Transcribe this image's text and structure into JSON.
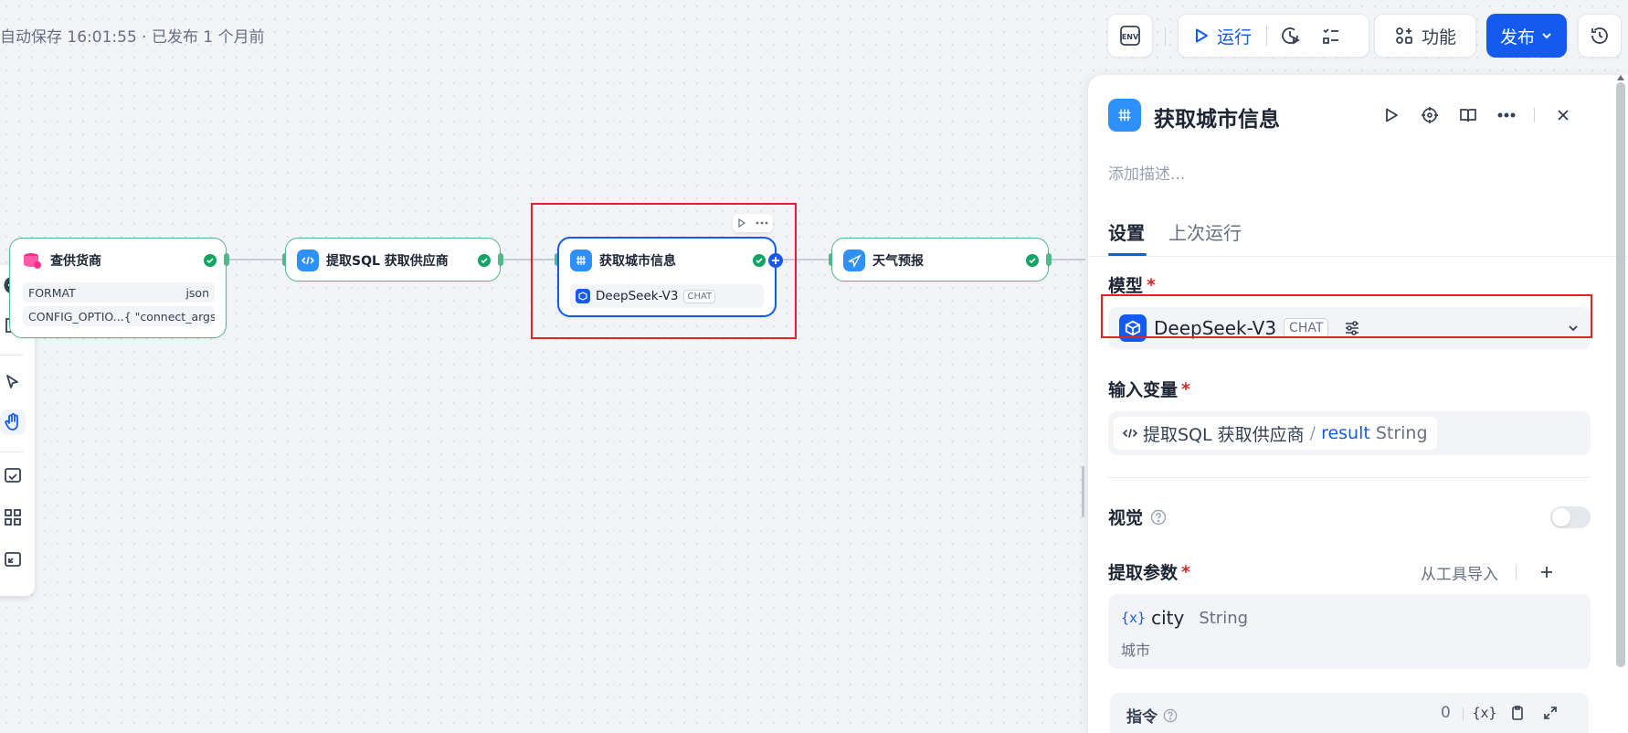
{
  "status_text": "自动保存 16:01:55 · 已发布 1 个月前",
  "toolbar": {
    "env_label": "ENV",
    "run_label": "运行",
    "features_label": "功能",
    "publish_label": "发布"
  },
  "nodes": {
    "supplier": {
      "title": "查供货商",
      "rows": [
        {
          "key": "FORMAT",
          "value": "json"
        },
        {
          "key": "CONFIG_OPTIO...",
          "value": "{ \"connect_args..."
        }
      ]
    },
    "sql": {
      "title": "提取SQL 获取供应商"
    },
    "city": {
      "title": "获取城市信息",
      "model": "DeepSeek-V3",
      "model_badge": "CHAT"
    },
    "weather": {
      "title": "天气预报"
    }
  },
  "panel": {
    "title": "获取城市信息",
    "description_placeholder": "添加描述...",
    "tabs": [
      "设置",
      "上次运行"
    ],
    "model_label": "模型",
    "model_name": "DeepSeek-V3",
    "model_badge": "CHAT",
    "input_var_label": "输入变量",
    "input_var": {
      "node": "提取SQL 获取供应商",
      "sep": "/",
      "name": "result",
      "type": "String"
    },
    "vision_label": "视觉",
    "vision_enabled": false,
    "extract_label": "提取参数",
    "import_label": "从工具导入",
    "param": {
      "name": "city",
      "type": "String",
      "desc": "城市"
    },
    "instruction_label": "指令",
    "instruction_count": "0"
  },
  "colors": {
    "accent": "#155aef",
    "success": "#12a464",
    "highlight": "#e02424"
  }
}
